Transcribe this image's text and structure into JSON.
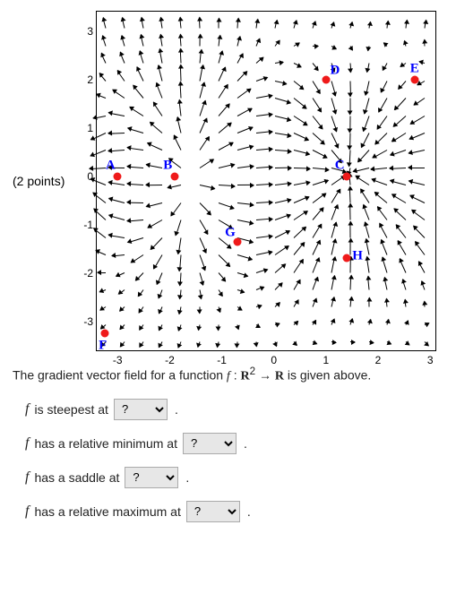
{
  "points_label": "(2 points)",
  "caption_prefix": "The gradient vector field for a function ",
  "caption_math_f": "f",
  "caption_math_map": " : ",
  "caption_math_R2": "R",
  "caption_math_sup": "2",
  "caption_math_arrow": " → ",
  "caption_math_R": "R",
  "caption_suffix": " is given above.",
  "questions": [
    {
      "id": "q1",
      "pre": " is steepest at",
      "options": [
        "?",
        "A",
        "B",
        "C",
        "D",
        "E",
        "F",
        "G",
        "H"
      ],
      "selected": "?"
    },
    {
      "id": "q2",
      "pre": " has a relative minimum at",
      "options": [
        "?",
        "A",
        "B",
        "C",
        "D",
        "E",
        "F",
        "G",
        "H"
      ],
      "selected": "?"
    },
    {
      "id": "q3",
      "pre": " has a saddle at",
      "options": [
        "?",
        "A",
        "B",
        "C",
        "D",
        "E",
        "F",
        "G",
        "H"
      ],
      "selected": "?"
    },
    {
      "id": "q4",
      "pre": " has a relative maximum at",
      "options": [
        "?",
        "A",
        "B",
        "C",
        "D",
        "E",
        "F",
        "G",
        "H"
      ],
      "selected": "?"
    }
  ],
  "chart_data": {
    "type": "vector-field",
    "xlim": [
      -3.4,
      3.1
    ],
    "ylim": [
      -3.6,
      3.4
    ],
    "xticks": [
      -3,
      -2,
      -1,
      0,
      1,
      2,
      3
    ],
    "yticks": [
      -3,
      -2,
      -1,
      0,
      1,
      2,
      3
    ],
    "labeled_points": [
      {
        "name": "A",
        "x": -3.0,
        "y": 0.0
      },
      {
        "name": "B",
        "x": -1.9,
        "y": 0.0
      },
      {
        "name": "C",
        "x": 1.4,
        "y": 0.0
      },
      {
        "name": "D",
        "x": 1.0,
        "y": 2.0
      },
      {
        "name": "E",
        "x": 2.7,
        "y": 2.0
      },
      {
        "name": "F",
        "x": -3.25,
        "y": -3.25
      },
      {
        "name": "G",
        "x": -0.7,
        "y": -1.35
      },
      {
        "name": "H",
        "x": 1.4,
        "y": -1.7
      }
    ],
    "label_offsets": {
      "A": [
        -8,
        -12
      ],
      "B": [
        -8,
        -12
      ],
      "C": [
        -8,
        -12
      ],
      "D": [
        10,
        -10
      ],
      "E": [
        0,
        -12
      ],
      "F": [
        -2,
        14
      ],
      "G": [
        -8,
        -10
      ],
      "H": [
        12,
        -2
      ]
    }
  }
}
